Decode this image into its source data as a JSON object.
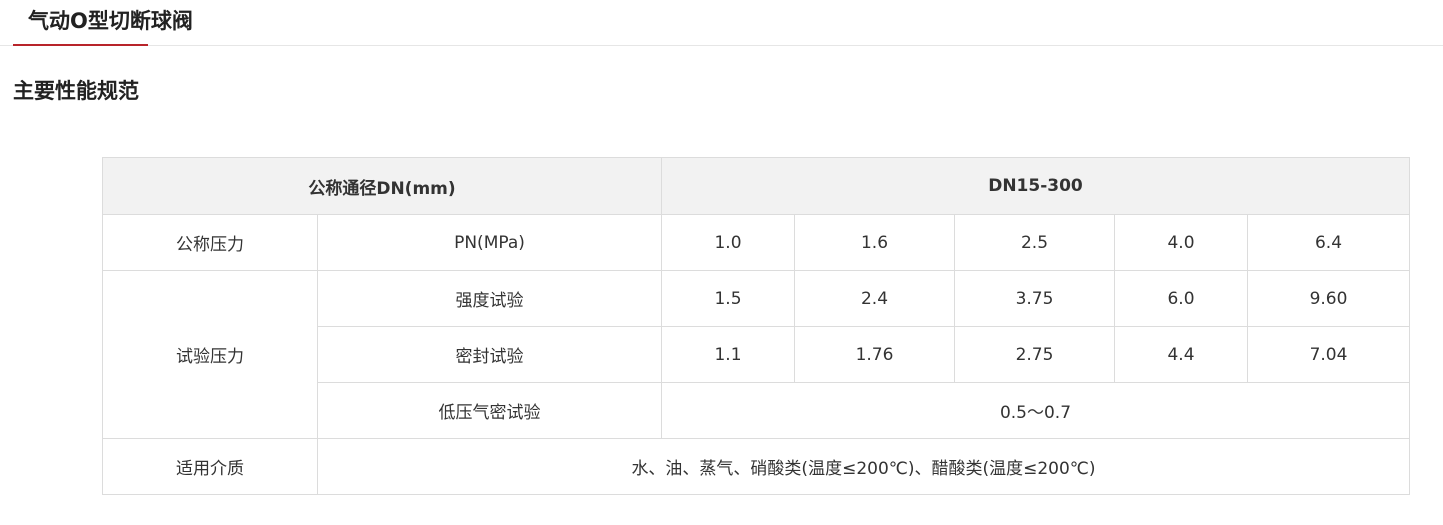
{
  "tab": {
    "title": "气动O型切断球阀",
    "accent_color": "#b8242a"
  },
  "section": {
    "title": "主要性能规范"
  },
  "table": {
    "header": {
      "left": "公称通径DN(mm)",
      "right": "DN15-300"
    },
    "nominal_pressure": {
      "label": "公称压力",
      "sub_label": "PN(MPa)",
      "values": [
        "1.0",
        "1.6",
        "2.5",
        "4.0",
        "6.4"
      ]
    },
    "test_pressure": {
      "label": "试验压力",
      "strength": {
        "label": "强度试验",
        "values": [
          "1.5",
          "2.4",
          "3.75",
          "6.0",
          "9.60"
        ]
      },
      "seal": {
        "label": "密封试验",
        "values": [
          "1.1",
          "1.76",
          "2.75",
          "4.4",
          "7.04"
        ]
      },
      "low_pressure_gas": {
        "label": "低压气密试验",
        "value": "0.5～0.7"
      }
    },
    "medium": {
      "label": "适用介质",
      "value": "水、油、蒸气、硝酸类(温度≤200℃)、醋酸类(温度≤200℃)"
    }
  }
}
